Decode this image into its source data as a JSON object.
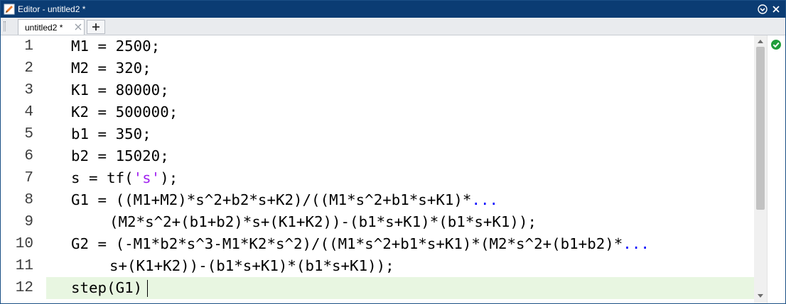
{
  "window": {
    "title": "Editor - untitled2 *"
  },
  "tabs": [
    {
      "label": "untitled2 *",
      "active": true
    }
  ],
  "icons": {
    "app": "editor-icon",
    "options": "options-chevron-icon",
    "close_window": "close-icon",
    "close_tab": "close-tab-icon",
    "new_tab": "plus-icon",
    "code_analyzer": "checkmark-circle-icon",
    "scroll_up": "arrow-up-icon",
    "scroll_down": "arrow-down-icon"
  },
  "colors": {
    "titlebar": "#0b3c73",
    "current_line": "#e8f6e1",
    "string": "#a020f0",
    "continuation": "#0000ff",
    "analyzer_ok": "#1f9d3a"
  },
  "editor": {
    "current_line": 12,
    "lines": [
      {
        "num": "1",
        "code": "M1 = 2500;"
      },
      {
        "num": "2",
        "code": "M2 = 320;"
      },
      {
        "num": "3",
        "code": "K1 = 80000;"
      },
      {
        "num": "4",
        "code": "K2 = 500000;"
      },
      {
        "num": "5",
        "code": "b1 = 350;"
      },
      {
        "num": "6",
        "code": "b2 = 15020;"
      },
      {
        "num": "7",
        "pre": "s = tf(",
        "str": "'s'",
        "post": ");"
      },
      {
        "num": "8",
        "code": "G1 = ((M1+M2)*s^2+b2*s+K2)/((M1*s^2+b1*s+K1)*",
        "dots": "..."
      },
      {
        "num": "9",
        "code": "(M2*s^2+(b1+b2)*s+(K1+K2))-(b1*s+K1)*(b1*s+K1));"
      },
      {
        "num": "10",
        "code": "G2 = (-M1*b2*s^3-M1*K2*s^2)/((M1*s^2+b1*s+K1)*(M2*s^2+(b1+b2)*",
        "dots": "..."
      },
      {
        "num": "11",
        "code": "s+(K1+K2))-(b1*s+K1)*(b1*s+K1));"
      },
      {
        "num": "12",
        "code": "step(G1)"
      }
    ]
  }
}
